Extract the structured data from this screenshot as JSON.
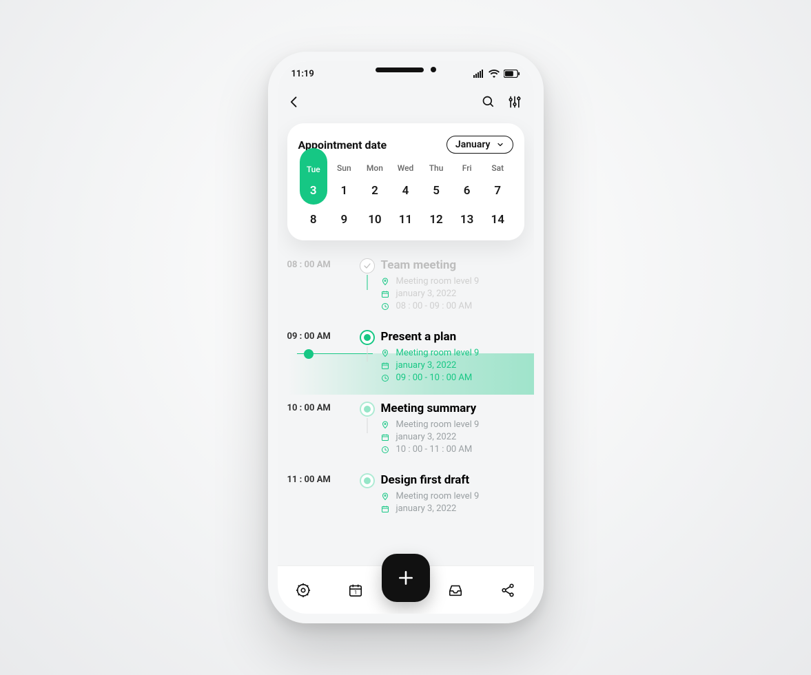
{
  "status": {
    "time": "11:19"
  },
  "card": {
    "title": "Appointment date",
    "month": "January",
    "dow": [
      "Sun",
      "Mon",
      "Tue",
      "Wed",
      "Thu",
      "Fri",
      "Sat"
    ],
    "row1": [
      "1",
      "2",
      "3",
      "4",
      "5",
      "6",
      "7"
    ],
    "row2": [
      "8",
      "9",
      "10",
      "11",
      "12",
      "13",
      "14"
    ],
    "selected_index": 2
  },
  "events": [
    {
      "time": "08 : 00 AM",
      "title": "Team meeting",
      "location": "Meeting room level 9",
      "date": "january 3, 2022",
      "range": "08 : 00 - 09 : 00 AM",
      "state": "done"
    },
    {
      "time": "09 : 00 AM",
      "title": "Present a plan",
      "location": "Meeting room level 9",
      "date": "january 3, 2022",
      "range": "09 : 00 - 10 : 00 AM",
      "state": "active"
    },
    {
      "time": "10 : 00 AM",
      "title": "Meeting summary",
      "location": "Meeting room level 9",
      "date": "january 3, 2022",
      "range": "10 : 00 - 11 : 00 AM",
      "state": "upcoming"
    },
    {
      "time": "11 : 00 AM",
      "title": "Design first draft",
      "location": "Meeting room level 9",
      "date": "january 3, 2022",
      "range": "",
      "state": "upcoming"
    }
  ]
}
